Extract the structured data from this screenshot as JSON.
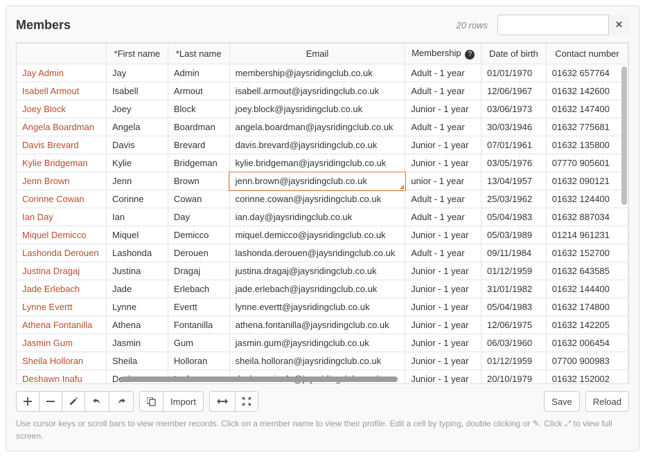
{
  "title": "Members",
  "row_count_label": "20 rows",
  "search": {
    "value": "",
    "placeholder": ""
  },
  "columns": {
    "blank": "",
    "first_name": "*First name",
    "last_name": "*Last name",
    "email": "Email",
    "membership": "Membership",
    "dob": "Date of birth",
    "contact": "Contact number"
  },
  "editing_cell": {
    "row": 6,
    "col": "email"
  },
  "toolbar": {
    "import": "Import",
    "save": "Save",
    "reload": "Reload"
  },
  "help_text": "Use cursor keys or scroll bars to view member records. Click on a member name to view their profile. Edit a cell by typing, double clicking or ✎. Click ⤢ to view full screen.",
  "rows": [
    {
      "full": "Jay Admin",
      "first": "Jay",
      "last": "Admin",
      "email": "membership@jaysridingclub.co.uk",
      "membership": "Adult - 1 year",
      "dob": "01/01/1970",
      "contact": "01632 657764"
    },
    {
      "full": "Isabell Armout",
      "first": "Isabell",
      "last": "Armout",
      "email": "isabell.armout@jaysridingclub.co.uk",
      "membership": "Adult - 1 year",
      "dob": "12/06/1967",
      "contact": "01632 142600"
    },
    {
      "full": "Joey Block",
      "first": "Joey",
      "last": "Block",
      "email": "joey.block@jaysridingclub.co.uk",
      "membership": "Junior - 1 year",
      "dob": "03/06/1973",
      "contact": "01632 147400"
    },
    {
      "full": "Angela Boardman",
      "first": "Angela",
      "last": "Boardman",
      "email": "angela.boardman@jaysridingclub.co.uk",
      "membership": "Adult - 1 year",
      "dob": "30/03/1946",
      "contact": "01632 775681"
    },
    {
      "full": "Davis Brevard",
      "first": "Davis",
      "last": "Brevard",
      "email": "davis.brevard@jaysridingclub.co.uk",
      "membership": "Junior - 1 year",
      "dob": "07/01/1961",
      "contact": "01632 135800"
    },
    {
      "full": "Kylie Bridgeman",
      "first": "Kylie",
      "last": "Bridgeman",
      "email": "kylie.bridgeman@jaysridingclub.co.uk",
      "membership": "Junior - 1 year",
      "dob": "03/05/1976",
      "contact": "07770 905601"
    },
    {
      "full": "Jenn Brown",
      "first": "Jenn",
      "last": "Brown",
      "email": "jenn.brown@jaysridingclub.co.uk",
      "membership": "unior - 1 year",
      "dob": "13/04/1957",
      "contact": "01632 090121"
    },
    {
      "full": "Corinne Cowan",
      "first": "Corinne",
      "last": "Cowan",
      "email": "corinne.cowan@jaysridingclub.co.uk",
      "membership": "Adult - 1 year",
      "dob": "25/03/1962",
      "contact": "01632 124400"
    },
    {
      "full": "Ian Day",
      "first": "Ian",
      "last": "Day",
      "email": "ian.day@jaysridingclub.co.uk",
      "membership": "Adult - 1 year",
      "dob": "05/04/1983",
      "contact": "01632 887034"
    },
    {
      "full": "Miquel Demicco",
      "first": "Miquel",
      "last": "Demicco",
      "email": "miquel.demicco@jaysridingclub.co.uk",
      "membership": "Junior - 1 year",
      "dob": "05/03/1989",
      "contact": "01214 961231"
    },
    {
      "full": "Lashonda Derouen",
      "first": "Lashonda",
      "last": "Derouen",
      "email": "lashonda.derouen@jaysridingclub.co.uk",
      "membership": "Adult - 1 year",
      "dob": "09/11/1984",
      "contact": "01632 152700"
    },
    {
      "full": "Justina Dragaj",
      "first": "Justina",
      "last": "Dragaj",
      "email": "justina.dragaj@jaysridingclub.co.uk",
      "membership": "Junior - 1 year",
      "dob": "01/12/1959",
      "contact": "01632 643585"
    },
    {
      "full": "Jade Erlebach",
      "first": "Jade",
      "last": "Erlebach",
      "email": "jade.erlebach@jaysridingclub.co.uk",
      "membership": "Junior - 1 year",
      "dob": "31/01/1982",
      "contact": "01632 144400"
    },
    {
      "full": "Lynne Evertt",
      "first": "Lynne",
      "last": "Evertt",
      "email": "lynne.evertt@jaysridingclub.co.uk",
      "membership": "Junior - 1 year",
      "dob": "05/04/1983",
      "contact": "01632 174800"
    },
    {
      "full": "Athena Fontanilla",
      "first": "Athena",
      "last": "Fontanilla",
      "email": "athena.fontanilla@jaysridingclub.co.uk",
      "membership": "Junior - 1 year",
      "dob": "12/06/1975",
      "contact": "01632 142205"
    },
    {
      "full": "Jasmin Gum",
      "first": "Jasmin",
      "last": "Gum",
      "email": "jasmin.gum@jaysridingclub.co.uk",
      "membership": "Junior - 1 year",
      "dob": "06/03/1960",
      "contact": "01632 006454"
    },
    {
      "full": "Sheila Holloran",
      "first": "Sheila",
      "last": "Holloran",
      "email": "sheila.holloran@jaysridingclub.co.uk",
      "membership": "Junior - 1 year",
      "dob": "01/12/1959",
      "contact": "07700 900983"
    },
    {
      "full": "Deshawn Inafu",
      "first": "Deshawn",
      "last": "Inafu",
      "email": "deshawn.inafu@jaysridingclub.co.uk",
      "membership": "Junior - 1 year",
      "dob": "20/10/1979",
      "contact": "01632 152002"
    }
  ]
}
